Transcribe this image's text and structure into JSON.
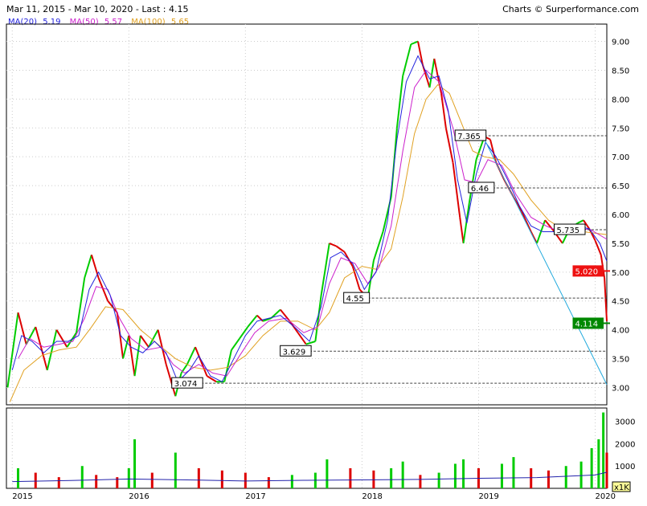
{
  "header": {
    "range_text": "Mar 11, 2015 - Mar 10, 2020 - Last : 4.15",
    "credit_text": "Charts © Surperformance.com"
  },
  "legend": [
    {
      "name": "MA(20)",
      "value": "5.19",
      "color": "#2222dd"
    },
    {
      "name": "MA(50)",
      "value": "5.57",
      "color": "#cc22cc"
    },
    {
      "name": "MA(100)",
      "value": "5.65",
      "color": "#e0a020"
    }
  ],
  "colors": {
    "up": "#00cc00",
    "down": "#dd0000",
    "trendline": "#22aadd",
    "ref_line": "#444444",
    "last_box": "#008800",
    "ma_box": "#ee1111"
  },
  "chart_data": {
    "type": "line",
    "title": "",
    "xlabel": "",
    "ylabel": "",
    "ylim": [
      2.7,
      9.3
    ],
    "y_ticks": [
      "3.00",
      "3.50",
      "4.00",
      "4.50",
      "5.00",
      "5.50",
      "6.00",
      "6.50",
      "7.00",
      "7.50",
      "8.00",
      "8.50",
      "9.00"
    ],
    "x_ticks": [
      "2015",
      "2016",
      "2017",
      "2018",
      "2019",
      "2020"
    ],
    "x_tick_pos": [
      2015.0,
      2016.0,
      2017.0,
      2018.0,
      2019.0,
      2020.0
    ],
    "xlim": [
      2014.95,
      2020.1
    ],
    "price": [
      [
        2014.96,
        3.0
      ],
      [
        2015.05,
        4.3
      ],
      [
        2015.12,
        3.75
      ],
      [
        2015.2,
        4.05
      ],
      [
        2015.3,
        3.3
      ],
      [
        2015.38,
        4.0
      ],
      [
        2015.47,
        3.7
      ],
      [
        2015.55,
        3.95
      ],
      [
        2015.62,
        4.9
      ],
      [
        2015.68,
        5.3
      ],
      [
        2015.74,
        4.9
      ],
      [
        2015.82,
        4.5
      ],
      [
        2015.9,
        4.3
      ],
      [
        2015.95,
        3.5
      ],
      [
        2016.0,
        3.9
      ],
      [
        2016.05,
        3.2
      ],
      [
        2016.1,
        3.9
      ],
      [
        2016.17,
        3.7
      ],
      [
        2016.25,
        4.0
      ],
      [
        2016.32,
        3.4
      ],
      [
        2016.4,
        2.85
      ],
      [
        2016.45,
        3.25
      ],
      [
        2016.5,
        3.4
      ],
      [
        2016.57,
        3.7
      ],
      [
        2016.62,
        3.45
      ],
      [
        2016.67,
        3.2
      ],
      [
        2016.75,
        3.1
      ],
      [
        2016.82,
        3.1
      ],
      [
        2016.88,
        3.65
      ],
      [
        2016.95,
        3.85
      ],
      [
        2017.02,
        4.05
      ],
      [
        2017.1,
        4.25
      ],
      [
        2017.15,
        4.15
      ],
      [
        2017.22,
        4.2
      ],
      [
        2017.3,
        4.35
      ],
      [
        2017.38,
        4.15
      ],
      [
        2017.45,
        3.95
      ],
      [
        2017.52,
        3.75
      ],
      [
        2017.6,
        3.8
      ],
      [
        2017.65,
        4.6
      ],
      [
        2017.72,
        5.5
      ],
      [
        2017.78,
        5.45
      ],
      [
        2017.85,
        5.35
      ],
      [
        2017.92,
        5.1
      ],
      [
        2017.98,
        4.7
      ],
      [
        2018.05,
        4.55
      ],
      [
        2018.1,
        5.2
      ],
      [
        2018.18,
        5.7
      ],
      [
        2018.25,
        6.3
      ],
      [
        2018.3,
        7.5
      ],
      [
        2018.35,
        8.4
      ],
      [
        2018.42,
        8.95
      ],
      [
        2018.48,
        9.0
      ],
      [
        2018.52,
        8.6
      ],
      [
        2018.58,
        8.2
      ],
      [
        2018.62,
        8.7
      ],
      [
        2018.68,
        8.1
      ],
      [
        2018.72,
        7.5
      ],
      [
        2018.78,
        6.9
      ],
      [
        2018.84,
        5.95
      ],
      [
        2018.87,
        5.5
      ],
      [
        2018.92,
        6.2
      ],
      [
        2018.98,
        6.95
      ],
      [
        2019.05,
        7.35
      ],
      [
        2019.1,
        7.3
      ],
      [
        2019.15,
        6.9
      ],
      [
        2019.22,
        6.6
      ],
      [
        2019.3,
        6.3
      ],
      [
        2019.37,
        6.05
      ],
      [
        2019.45,
        5.7
      ],
      [
        2019.5,
        5.5
      ],
      [
        2019.57,
        5.9
      ],
      [
        2019.65,
        5.7
      ],
      [
        2019.72,
        5.5
      ],
      [
        2019.78,
        5.75
      ],
      [
        2019.85,
        5.85
      ],
      [
        2019.9,
        5.9
      ],
      [
        2019.95,
        5.75
      ],
      [
        2020.0,
        5.55
      ],
      [
        2020.05,
        5.3
      ],
      [
        2020.08,
        4.9
      ],
      [
        2020.1,
        4.15
      ]
    ],
    "ma20": [
      [
        2015.0,
        3.3
      ],
      [
        2015.08,
        3.9
      ],
      [
        2015.17,
        3.8
      ],
      [
        2015.27,
        3.6
      ],
      [
        2015.38,
        3.8
      ],
      [
        2015.48,
        3.8
      ],
      [
        2015.57,
        3.9
      ],
      [
        2015.66,
        4.7
      ],
      [
        2015.74,
        5.0
      ],
      [
        2015.84,
        4.6
      ],
      [
        2015.93,
        3.9
      ],
      [
        2016.02,
        3.7
      ],
      [
        2016.12,
        3.6
      ],
      [
        2016.22,
        3.8
      ],
      [
        2016.32,
        3.6
      ],
      [
        2016.42,
        3.1
      ],
      [
        2016.52,
        3.3
      ],
      [
        2016.6,
        3.55
      ],
      [
        2016.7,
        3.2
      ],
      [
        2016.8,
        3.1
      ],
      [
        2016.9,
        3.5
      ],
      [
        2017.0,
        3.9
      ],
      [
        2017.1,
        4.15
      ],
      [
        2017.2,
        4.2
      ],
      [
        2017.3,
        4.25
      ],
      [
        2017.42,
        4.05
      ],
      [
        2017.55,
        3.8
      ],
      [
        2017.65,
        4.4
      ],
      [
        2017.73,
        5.25
      ],
      [
        2017.82,
        5.35
      ],
      [
        2017.92,
        5.15
      ],
      [
        2018.02,
        4.7
      ],
      [
        2018.12,
        5.0
      ],
      [
        2018.22,
        5.9
      ],
      [
        2018.3,
        7.3
      ],
      [
        2018.38,
        8.3
      ],
      [
        2018.48,
        8.75
      ],
      [
        2018.58,
        8.35
      ],
      [
        2018.66,
        8.4
      ],
      [
        2018.74,
        7.8
      ],
      [
        2018.82,
        6.6
      ],
      [
        2018.9,
        5.85
      ],
      [
        2018.98,
        6.7
      ],
      [
        2019.06,
        7.25
      ],
      [
        2019.15,
        7.0
      ],
      [
        2019.25,
        6.6
      ],
      [
        2019.35,
        6.15
      ],
      [
        2019.45,
        5.8
      ],
      [
        2019.55,
        5.7
      ],
      [
        2019.65,
        5.7
      ],
      [
        2019.75,
        5.65
      ],
      [
        2019.85,
        5.8
      ],
      [
        2019.95,
        5.75
      ],
      [
        2020.04,
        5.5
      ],
      [
        2020.1,
        5.19
      ]
    ],
    "ma50": [
      [
        2015.05,
        3.5
      ],
      [
        2015.15,
        3.85
      ],
      [
        2015.27,
        3.7
      ],
      [
        2015.4,
        3.75
      ],
      [
        2015.52,
        3.8
      ],
      [
        2015.62,
        4.2
      ],
      [
        2015.72,
        4.75
      ],
      [
        2015.82,
        4.7
      ],
      [
        2015.92,
        4.2
      ],
      [
        2016.02,
        3.85
      ],
      [
        2016.15,
        3.65
      ],
      [
        2016.28,
        3.7
      ],
      [
        2016.38,
        3.4
      ],
      [
        2016.48,
        3.25
      ],
      [
        2016.6,
        3.4
      ],
      [
        2016.72,
        3.25
      ],
      [
        2016.84,
        3.2
      ],
      [
        2016.95,
        3.55
      ],
      [
        2017.08,
        3.95
      ],
      [
        2017.2,
        4.15
      ],
      [
        2017.35,
        4.2
      ],
      [
        2017.5,
        3.95
      ],
      [
        2017.62,
        4.05
      ],
      [
        2017.72,
        4.8
      ],
      [
        2017.82,
        5.25
      ],
      [
        2017.94,
        5.15
      ],
      [
        2018.05,
        4.8
      ],
      [
        2018.15,
        5.1
      ],
      [
        2018.25,
        5.8
      ],
      [
        2018.35,
        7.1
      ],
      [
        2018.45,
        8.2
      ],
      [
        2018.55,
        8.5
      ],
      [
        2018.66,
        8.3
      ],
      [
        2018.78,
        7.5
      ],
      [
        2018.88,
        6.6
      ],
      [
        2018.98,
        6.55
      ],
      [
        2019.08,
        6.95
      ],
      [
        2019.2,
        6.85
      ],
      [
        2019.32,
        6.35
      ],
      [
        2019.45,
        5.95
      ],
      [
        2019.58,
        5.8
      ],
      [
        2019.7,
        5.7
      ],
      [
        2019.82,
        5.72
      ],
      [
        2019.95,
        5.75
      ],
      [
        2020.1,
        5.57
      ]
    ],
    "ma100": [
      [
        2014.98,
        2.75
      ],
      [
        2015.1,
        3.3
      ],
      [
        2015.25,
        3.55
      ],
      [
        2015.4,
        3.65
      ],
      [
        2015.55,
        3.7
      ],
      [
        2015.68,
        4.05
      ],
      [
        2015.8,
        4.4
      ],
      [
        2015.95,
        4.35
      ],
      [
        2016.1,
        4.0
      ],
      [
        2016.25,
        3.75
      ],
      [
        2016.4,
        3.5
      ],
      [
        2016.55,
        3.35
      ],
      [
        2016.7,
        3.3
      ],
      [
        2016.85,
        3.35
      ],
      [
        2017.0,
        3.55
      ],
      [
        2017.15,
        3.9
      ],
      [
        2017.3,
        4.15
      ],
      [
        2017.45,
        4.15
      ],
      [
        2017.6,
        4.0
      ],
      [
        2017.72,
        4.3
      ],
      [
        2017.85,
        4.9
      ],
      [
        2018.0,
        5.1
      ],
      [
        2018.12,
        5.05
      ],
      [
        2018.25,
        5.4
      ],
      [
        2018.35,
        6.3
      ],
      [
        2018.45,
        7.4
      ],
      [
        2018.55,
        8.0
      ],
      [
        2018.65,
        8.25
      ],
      [
        2018.75,
        8.1
      ],
      [
        2018.85,
        7.6
      ],
      [
        2018.95,
        7.1
      ],
      [
        2019.05,
        7.0
      ],
      [
        2019.18,
        6.95
      ],
      [
        2019.3,
        6.7
      ],
      [
        2019.45,
        6.25
      ],
      [
        2019.6,
        5.9
      ],
      [
        2019.75,
        5.7
      ],
      [
        2019.9,
        5.7
      ],
      [
        2020.1,
        5.65
      ]
    ],
    "trendline": [
      [
        2019.05,
        7.3
      ],
      [
        2020.1,
        3.05
      ]
    ],
    "ref_lines": [
      {
        "y": 7.365,
        "x_start": 2019.05,
        "label": "7.365"
      },
      {
        "y": 6.46,
        "x_start": 2019.12,
        "label": "6.46"
      },
      {
        "y": 5.735,
        "x_start": 2019.9,
        "label": "5.735"
      },
      {
        "y": 4.55,
        "x_start": 2018.05,
        "label": "4.55"
      },
      {
        "y": 3.629,
        "x_start": 2017.55,
        "label": "3.629"
      },
      {
        "y": 3.074,
        "x_start": 2016.62,
        "label": "3.074"
      }
    ],
    "ma_marker": {
      "y": 5.02,
      "label": "5.020"
    },
    "last_marker": {
      "y": 4.114,
      "label": "4.114"
    },
    "volume": {
      "ylim": [
        0,
        3600
      ],
      "y_ticks": [
        "1000",
        "2000",
        "3000"
      ],
      "unit_label": "x1K",
      "bars": [
        [
          2015.05,
          900
        ],
        [
          2015.2,
          700
        ],
        [
          2015.4,
          500
        ],
        [
          2015.6,
          1000
        ],
        [
          2015.72,
          600
        ],
        [
          2015.9,
          500
        ],
        [
          2016.0,
          900
        ],
        [
          2016.05,
          2200
        ],
        [
          2016.2,
          700
        ],
        [
          2016.4,
          1600
        ],
        [
          2016.6,
          900
        ],
        [
          2016.8,
          800
        ],
        [
          2017.0,
          700
        ],
        [
          2017.2,
          500
        ],
        [
          2017.4,
          600
        ],
        [
          2017.6,
          700
        ],
        [
          2017.7,
          1300
        ],
        [
          2017.9,
          900
        ],
        [
          2018.1,
          800
        ],
        [
          2018.25,
          900
        ],
        [
          2018.35,
          1200
        ],
        [
          2018.5,
          600
        ],
        [
          2018.66,
          700
        ],
        [
          2018.8,
          1100
        ],
        [
          2018.87,
          1300
        ],
        [
          2019.0,
          900
        ],
        [
          2019.2,
          1100
        ],
        [
          2019.3,
          1400
        ],
        [
          2019.45,
          900
        ],
        [
          2019.6,
          800
        ],
        [
          2019.75,
          1000
        ],
        [
          2019.88,
          1200
        ],
        [
          2019.97,
          1800
        ],
        [
          2020.03,
          2200
        ],
        [
          2020.07,
          3400
        ],
        [
          2020.1,
          1600
        ]
      ],
      "avg": [
        [
          2015.0,
          300
        ],
        [
          2015.5,
          350
        ],
        [
          2016.0,
          420
        ],
        [
          2016.5,
          380
        ],
        [
          2017.0,
          330
        ],
        [
          2017.5,
          360
        ],
        [
          2018.0,
          380
        ],
        [
          2018.5,
          400
        ],
        [
          2019.0,
          450
        ],
        [
          2019.5,
          480
        ],
        [
          2020.0,
          600
        ],
        [
          2020.1,
          720
        ]
      ]
    }
  }
}
